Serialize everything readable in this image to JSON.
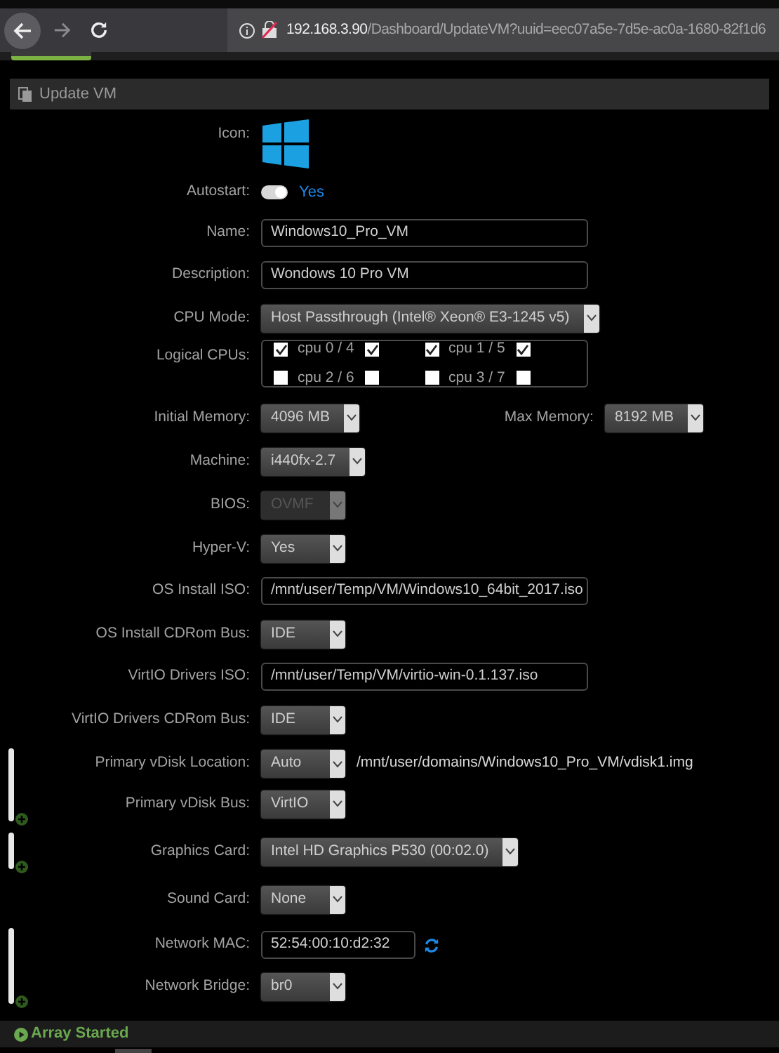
{
  "browser": {
    "url_host": "192.168.3.90",
    "url_path": "/Dashboard/UpdateVM?uuid=eec07a5e-7d5e-ac0a-1680-82f1d6",
    "forward_disabled": true
  },
  "panel": {
    "title": "Update VM"
  },
  "sections": [
    {
      "expandable": false,
      "fields": [
        {
          "kind": "icon",
          "label": "Icon:"
        },
        {
          "kind": "toggle",
          "label": "Autostart:",
          "on": true,
          "value": "Yes"
        },
        {
          "kind": "text",
          "label": "Name:",
          "value": "Windows10_Pro_VM"
        },
        {
          "kind": "text",
          "label": "Description:",
          "value": "Wondows 10 Pro VM"
        },
        {
          "kind": "select",
          "label": "CPU Mode:",
          "value": "Host Passthrough (Intel® Xeon® E3-1245 v5)",
          "disabled": false
        },
        {
          "kind": "cpus",
          "label": "Logical CPUs:",
          "cpus": [
            {
              "label": "cpu 0 / 4",
              "threads": [
                {
                  "checked": true
                },
                {
                  "checked": true
                }
              ]
            },
            {
              "label": "cpu 1 / 5",
              "threads": [
                {
                  "checked": true
                },
                {
                  "checked": true
                }
              ]
            },
            {
              "label": "cpu 2 / 6",
              "threads": [
                {
                  "checked": false
                },
                {
                  "checked": false
                }
              ]
            },
            {
              "label": "cpu 3 / 7",
              "threads": [
                {
                  "checked": false
                },
                {
                  "checked": false
                }
              ]
            }
          ]
        },
        {
          "kind": "memory",
          "label": "Initial Memory:",
          "value": "4096 MB",
          "max_label": "Max Memory:",
          "max_value": "8192 MB"
        },
        {
          "kind": "select",
          "label": "Machine:",
          "value": "i440fx-2.7",
          "disabled": false
        },
        {
          "kind": "select",
          "label": "BIOS:",
          "value": "OVMF",
          "disabled": true
        },
        {
          "kind": "select",
          "label": "Hyper-V:",
          "value": "Yes",
          "disabled": false
        },
        {
          "kind": "text",
          "label": "OS Install ISO:",
          "value": "/mnt/user/Temp/VM/Windows10_64bit_2017.iso"
        },
        {
          "kind": "select",
          "label": "OS Install CDRom Bus:",
          "value": "IDE",
          "disabled": false
        },
        {
          "kind": "text",
          "label": "VirtIO Drivers ISO:",
          "value": "/mnt/user/Temp/VM/virtio-win-0.1.137.iso"
        },
        {
          "kind": "select",
          "label": "VirtIO Drivers CDRom Bus:",
          "value": "IDE",
          "disabled": false
        }
      ]
    },
    {
      "expandable": true,
      "fields": [
        {
          "kind": "disk",
          "label": "Primary vDisk Location:",
          "value": "Auto",
          "path": "/mnt/user/domains/Windows10_Pro_VM/vdisk1.img"
        },
        {
          "kind": "select",
          "label": "Primary vDisk Bus:",
          "value": "VirtIO",
          "disabled": false
        }
      ]
    },
    {
      "expandable": true,
      "fields": [
        {
          "kind": "select",
          "label": "Graphics Card:",
          "value": "Intel HD Graphics P530 (00:02.0)",
          "disabled": false
        }
      ]
    },
    {
      "expandable": false,
      "fields": [
        {
          "kind": "select",
          "label": "Sound Card:",
          "value": "None",
          "disabled": false
        }
      ]
    },
    {
      "expandable": true,
      "fields": [
        {
          "kind": "mac",
          "label": "Network MAC:",
          "value": "52:54:00:10:d2:32"
        },
        {
          "kind": "select",
          "label": "Network Bridge:",
          "value": "br0",
          "disabled": false
        }
      ]
    }
  ],
  "status_bar": {
    "text": "Array Started"
  }
}
